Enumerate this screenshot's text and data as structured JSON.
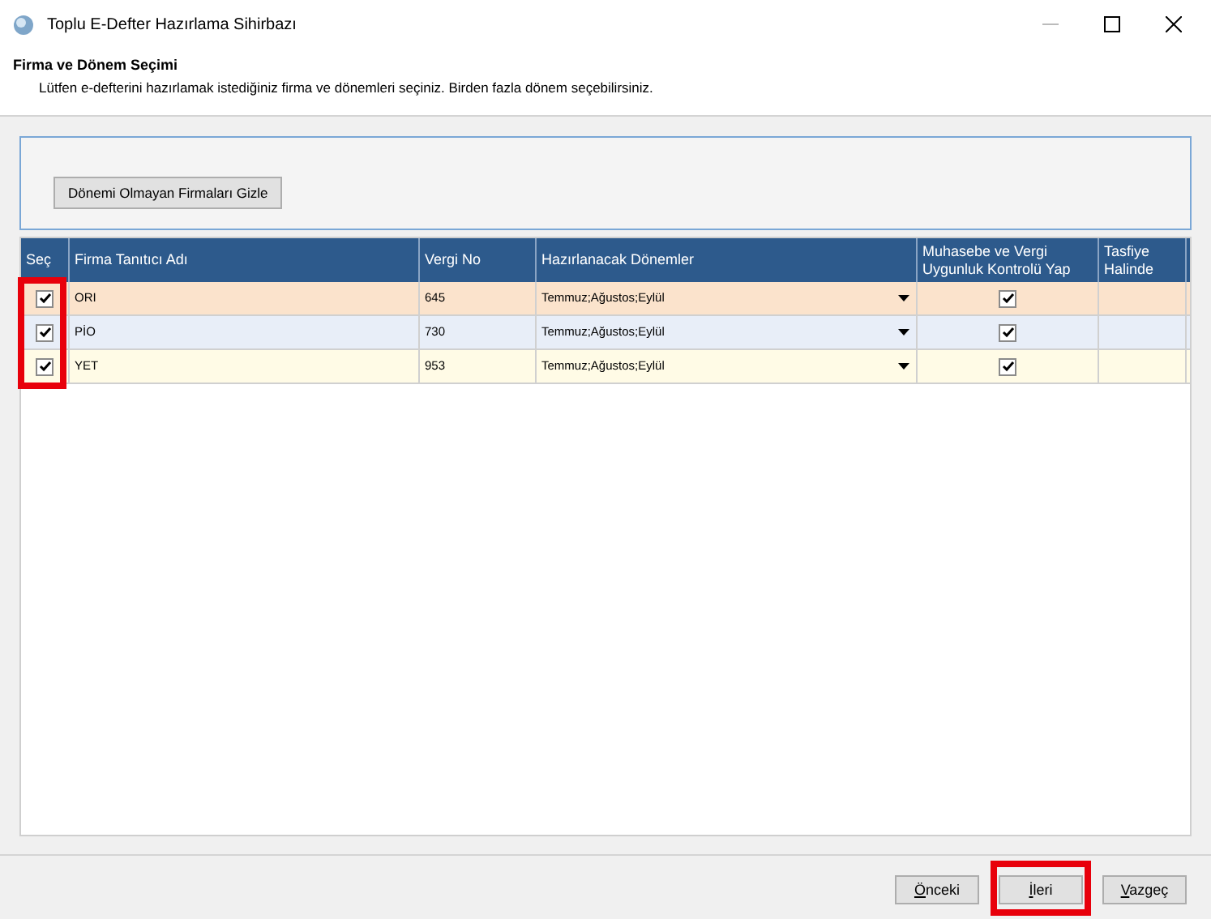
{
  "window": {
    "title": "Toplu E-Defter Hazırlama Sihirbazı"
  },
  "header": {
    "title": "Firma ve Dönem Seçimi",
    "description": "Lütfen e-defterini hazırlamak istediğiniz firma ve dönemleri seçiniz. Birden fazla dönem seçebilirsiniz."
  },
  "filter_button": "Dönemi Olmayan Firmaları Gizle",
  "table": {
    "columns": [
      "Seç",
      "Firma Tanıtıcı Adı",
      "Vergi No",
      "Hazırlanacak Dönemler",
      "Muhasebe ve Vergi Uygunluk Kontrolü  Yap",
      "Tasfiye Halinde"
    ],
    "rows": [
      {
        "checked": true,
        "firma": "ORI",
        "vergi_no": "645",
        "donemler": "Temmuz;Ağustos;Eylül",
        "kontrol": true,
        "color": "#fbe3cc"
      },
      {
        "checked": true,
        "firma": "PİO",
        "vergi_no": "730",
        "donemler": "Temmuz;Ağustos;Eylül",
        "kontrol": true,
        "color": "#e8eef8"
      },
      {
        "checked": true,
        "firma": "YET",
        "vergi_no": "953",
        "donemler": "Temmuz;Ağustos;Eylül",
        "kontrol": true,
        "color": "#fffbe6"
      }
    ]
  },
  "buttons": [
    {
      "label": "Önceki",
      "highlighted": false
    },
    {
      "label": "İleri",
      "highlighted": true
    },
    {
      "label": "Vazgeç",
      "highlighted": false
    }
  ]
}
